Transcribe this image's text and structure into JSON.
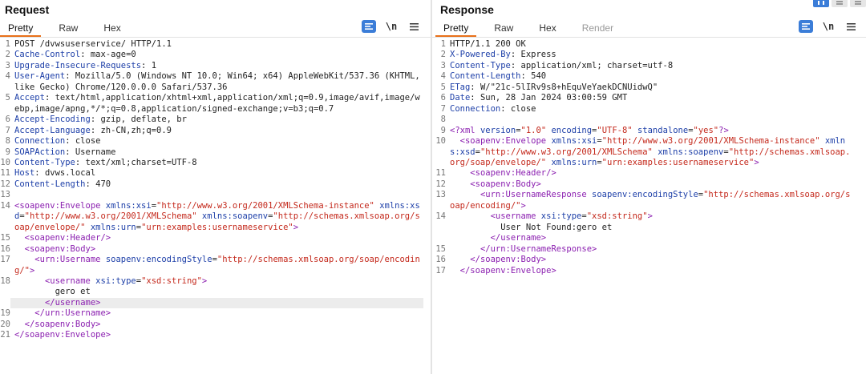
{
  "request": {
    "title": "Request",
    "tabs": [
      "Pretty",
      "Raw",
      "Hex"
    ],
    "active_tab": "Pretty",
    "tools": {
      "pretty_toggle": "pretty-toggle",
      "newline_label": "\\n",
      "menu_icon": "hamburger-menu"
    },
    "lines": [
      {
        "n": "1",
        "parts": [
          [
            "hv",
            "POST /dvwsuserservice/ HTTP/1.1"
          ]
        ]
      },
      {
        "n": "2",
        "parts": [
          [
            "hk",
            "Cache-Control"
          ],
          [
            "hv",
            ": max-age=0"
          ]
        ]
      },
      {
        "n": "3",
        "parts": [
          [
            "hk",
            "Upgrade-Insecure-Requests"
          ],
          [
            "hv",
            ": 1"
          ]
        ]
      },
      {
        "n": "4",
        "parts": [
          [
            "hk",
            "User-Agent"
          ],
          [
            "hv",
            ": Mozilla/5.0 (Windows NT 10.0; Win64; x64) AppleWebKit/537.36 (KHTML, like Gecko) Chrome/120.0.0.0 Safari/537.36"
          ]
        ]
      },
      {
        "n": "5",
        "parts": [
          [
            "hk",
            "Accept"
          ],
          [
            "hv",
            ": text/html,application/xhtml+xml,application/xml;q=0.9,image/avif,image/webp,image/apng,*/*;q=0.8,application/signed-exchange;v=b3;q=0.7"
          ]
        ]
      },
      {
        "n": "6",
        "parts": [
          [
            "hk",
            "Accept-Encoding"
          ],
          [
            "hv",
            ": gzip, deflate, br"
          ]
        ]
      },
      {
        "n": "7",
        "parts": [
          [
            "hk",
            "Accept-Language"
          ],
          [
            "hv",
            ": zh-CN,zh;q=0.9"
          ]
        ]
      },
      {
        "n": "8",
        "parts": [
          [
            "hk",
            "Connection"
          ],
          [
            "hv",
            ": close"
          ]
        ]
      },
      {
        "n": "9",
        "parts": [
          [
            "hk",
            "SOAPAction"
          ],
          [
            "hv",
            ": Username"
          ]
        ]
      },
      {
        "n": "10",
        "parts": [
          [
            "hk",
            "Content-Type"
          ],
          [
            "hv",
            ": text/xml;charset=UTF-8"
          ]
        ]
      },
      {
        "n": "11",
        "parts": [
          [
            "hk",
            "Host"
          ],
          [
            "hv",
            ": dvws.local"
          ]
        ]
      },
      {
        "n": "12",
        "parts": [
          [
            "hk",
            "Content-Length"
          ],
          [
            "hv",
            ": 470"
          ]
        ]
      },
      {
        "n": "13",
        "parts": []
      },
      {
        "n": "14",
        "parts": [
          [
            "tg",
            "<soapenv:Envelope "
          ],
          [
            "at",
            "xmlns:xsi"
          ],
          [
            "tx",
            "="
          ],
          [
            "av",
            "\"http://www.w3.org/2001/XMLSchema-instance\""
          ],
          [
            "tx",
            " "
          ],
          [
            "at",
            "xmlns:xsd"
          ],
          [
            "tx",
            "="
          ],
          [
            "av",
            "\"http://www.w3.org/2001/XMLSchema\""
          ],
          [
            "tx",
            " "
          ],
          [
            "at",
            "xmlns:soapenv"
          ],
          [
            "tx",
            "="
          ],
          [
            "av",
            "\"http://schemas.xmlsoap.org/soap/envelope/\""
          ],
          [
            "tx",
            " "
          ],
          [
            "at",
            "xmlns:urn"
          ],
          [
            "tx",
            "="
          ],
          [
            "av",
            "\"urn:examples:usernameservice\""
          ],
          [
            "tg",
            ">"
          ]
        ]
      },
      {
        "n": "15",
        "parts": [
          [
            "tx",
            "  "
          ],
          [
            "tg",
            "<soapenv:Header/>"
          ]
        ]
      },
      {
        "n": "16",
        "parts": [
          [
            "tx",
            "  "
          ],
          [
            "tg",
            "<soapenv:Body>"
          ]
        ]
      },
      {
        "n": "17",
        "parts": [
          [
            "tx",
            "    "
          ],
          [
            "tg",
            "<urn:Username "
          ],
          [
            "at",
            "soapenv:encodingStyle"
          ],
          [
            "tx",
            "="
          ],
          [
            "av",
            "\"http://schemas.xmlsoap.org/soap/encoding/\""
          ],
          [
            "tg",
            ">"
          ]
        ]
      },
      {
        "n": "18",
        "parts": [
          [
            "tx",
            "      "
          ],
          [
            "tg",
            "<username "
          ],
          [
            "at",
            "xsi:type"
          ],
          [
            "tx",
            "="
          ],
          [
            "av",
            "\"xsd:string\""
          ],
          [
            "tg",
            ">"
          ]
        ],
        "cont": "gero et"
      },
      {
        "n": "",
        "parts": [
          [
            "tx",
            "      "
          ],
          [
            "tg",
            "</username>"
          ]
        ],
        "hl": true
      },
      {
        "n": "19",
        "parts": [
          [
            "tx",
            "    "
          ],
          [
            "tg",
            "</urn:Username>"
          ]
        ]
      },
      {
        "n": "20",
        "parts": [
          [
            "tx",
            "  "
          ],
          [
            "tg",
            "</soapenv:Body>"
          ]
        ]
      },
      {
        "n": "21",
        "parts": [
          [
            "tg",
            "</soapenv:Envelope>"
          ]
        ]
      }
    ]
  },
  "response": {
    "title": "Response",
    "tabs": [
      "Pretty",
      "Raw",
      "Hex",
      "Render"
    ],
    "active_tab": "Pretty",
    "disabled_tab": "Render",
    "lines": [
      {
        "n": "1",
        "parts": [
          [
            "hv",
            "HTTP/1.1 200 OK"
          ]
        ]
      },
      {
        "n": "2",
        "parts": [
          [
            "hk",
            "X-Powered-By"
          ],
          [
            "hv",
            ": Express"
          ]
        ]
      },
      {
        "n": "3",
        "parts": [
          [
            "hk",
            "Content-Type"
          ],
          [
            "hv",
            ": application/xml; charset=utf-8"
          ]
        ]
      },
      {
        "n": "4",
        "parts": [
          [
            "hk",
            "Content-Length"
          ],
          [
            "hv",
            ": 540"
          ]
        ]
      },
      {
        "n": "5",
        "parts": [
          [
            "hk",
            "ETag"
          ],
          [
            "hv",
            ": W/\"21c-5lIRv9s8+hEquVeYaekDCNUidwQ\""
          ]
        ]
      },
      {
        "n": "6",
        "parts": [
          [
            "hk",
            "Date"
          ],
          [
            "hv",
            ": Sun, 28 Jan 2024 03:00:59 GMT"
          ]
        ]
      },
      {
        "n": "7",
        "parts": [
          [
            "hk",
            "Connection"
          ],
          [
            "hv",
            ": close"
          ]
        ]
      },
      {
        "n": "8",
        "parts": []
      },
      {
        "n": "9",
        "parts": [
          [
            "ptag",
            "<?xml "
          ],
          [
            "at",
            "version"
          ],
          [
            "tx",
            "="
          ],
          [
            "av",
            "\"1.0\""
          ],
          [
            "tx",
            " "
          ],
          [
            "at",
            "encoding"
          ],
          [
            "tx",
            "="
          ],
          [
            "av",
            "\"UTF-8\""
          ],
          [
            "tx",
            " "
          ],
          [
            "at",
            "standalone"
          ],
          [
            "tx",
            "="
          ],
          [
            "av",
            "\"yes\""
          ],
          [
            "ptag",
            "?>"
          ]
        ]
      },
      {
        "n": "10",
        "parts": [
          [
            "tx",
            "  "
          ],
          [
            "tg",
            "<soapenv:Envelope "
          ],
          [
            "at",
            "xmlns:xsi"
          ],
          [
            "tx",
            "="
          ],
          [
            "av",
            "\"http://www.w3.org/2001/XMLSchema-instance\""
          ],
          [
            "tx",
            " "
          ],
          [
            "at",
            "xmlns:xsd"
          ],
          [
            "tx",
            "="
          ],
          [
            "av",
            "\"http://www.w3.org/2001/XMLSchema\""
          ],
          [
            "tx",
            " "
          ],
          [
            "at",
            "xmlns:soapenv"
          ],
          [
            "tx",
            "="
          ],
          [
            "av",
            "\"http://schemas.xmlsoap.org/soap/envelope/\""
          ],
          [
            "tx",
            " "
          ],
          [
            "at",
            "xmlns:urn"
          ],
          [
            "tx",
            "="
          ],
          [
            "av",
            "\"urn:examples:usernameservice\""
          ],
          [
            "tg",
            ">"
          ]
        ]
      },
      {
        "n": "11",
        "parts": [
          [
            "tx",
            "    "
          ],
          [
            "tg",
            "<soapenv:Header/>"
          ]
        ]
      },
      {
        "n": "12",
        "parts": [
          [
            "tx",
            "    "
          ],
          [
            "tg",
            "<soapenv:Body>"
          ]
        ]
      },
      {
        "n": "13",
        "parts": [
          [
            "tx",
            "      "
          ],
          [
            "tg",
            "<urn:UsernameResponse "
          ],
          [
            "at",
            "soapenv:encodingStyle"
          ],
          [
            "tx",
            "="
          ],
          [
            "av",
            "\"http://schemas.xmlsoap.org/soap/encoding/\""
          ],
          [
            "tg",
            ">"
          ]
        ]
      },
      {
        "n": "14",
        "parts": [
          [
            "tx",
            "        "
          ],
          [
            "tg",
            "<username "
          ],
          [
            "at",
            "xsi:type"
          ],
          [
            "tx",
            "="
          ],
          [
            "av",
            "\"xsd:string\""
          ],
          [
            "tg",
            ">"
          ]
        ],
        "cont": "User Not Found:gero et"
      },
      {
        "n": "",
        "parts": [
          [
            "tx",
            "        "
          ],
          [
            "tg",
            "</username>"
          ]
        ]
      },
      {
        "n": "15",
        "parts": [
          [
            "tx",
            "      "
          ],
          [
            "tg",
            "</urn:UsernameResponse>"
          ]
        ]
      },
      {
        "n": "16",
        "parts": [
          [
            "tx",
            "    "
          ],
          [
            "tg",
            "</soapenv:Body>"
          ]
        ]
      },
      {
        "n": "17",
        "parts": [
          [
            "tx",
            "  "
          ],
          [
            "tg",
            "</soapenv:Envelope>"
          ]
        ]
      }
    ]
  },
  "view_toggles": [
    "split-horizontal",
    "split-vertical",
    "single-pane"
  ],
  "colors": {
    "accent_orange": "#e8701a",
    "toggle_blue": "#3b7dd8",
    "tag_purple": "#8b1fb0",
    "attr_blue": "#1d3fa8",
    "value_red": "#c4291c"
  }
}
